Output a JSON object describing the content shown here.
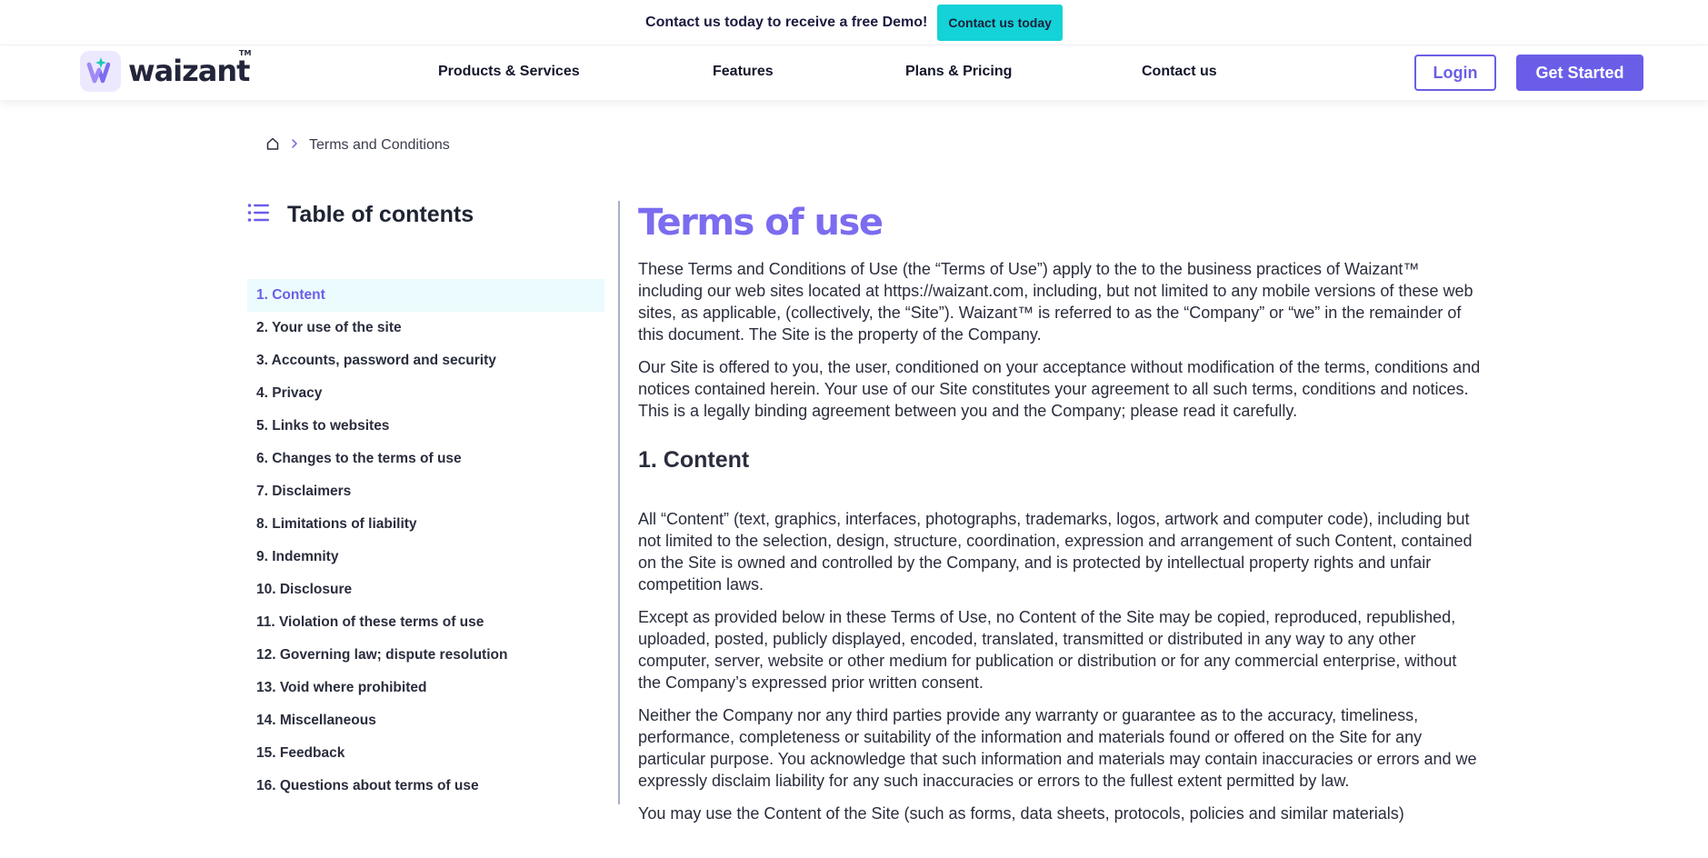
{
  "promo": {
    "text": "Contact us today to receive a free Demo!",
    "button_label": "Contact us today",
    "button_color": "#14d2d7"
  },
  "brand": {
    "name": "waizant",
    "tm": "TM",
    "accent": "#6a5ee8",
    "logo_icon": "waizant-w-sparkle-icon"
  },
  "nav": {
    "links": [
      "Products & Services",
      "Features",
      "Plans & Pricing",
      "Contact us"
    ],
    "login_label": "Login",
    "get_started_label": "Get Started"
  },
  "breadcrumb": {
    "home_icon": "home-icon",
    "separator_icon": "chevron-right-icon",
    "current": "Terms and Conditions"
  },
  "toc": {
    "title": "Table of contents",
    "icon": "list-icon",
    "active_index": 0,
    "items": [
      "1. Content",
      "2. Your use of the site",
      "3. Accounts, password and security",
      "4. Privacy",
      "5. Links to websites",
      "6. Changes to the terms of use",
      "7. Disclaimers",
      "8. Limitations of liability",
      "9. Indemnity",
      "10. Disclosure",
      "11. Violation of these terms of use",
      "12. Governing law; dispute resolution",
      "13. Void where prohibited",
      "14. Miscellaneous",
      "15. Feedback",
      "16. Questions about terms of use"
    ]
  },
  "main": {
    "title": "Terms of use",
    "intro": [
      "These Terms and Conditions of Use (the “Terms of Use”) apply to the to the business practices of Waizant™ including our web sites located at https://waizant.com, including, but not limited to any mobile versions of these web sites, as applicable, (collectively, the “Site”). Waizant™ is referred to as the “Company” or “we” in the remainder of this document. The Site is the property of the Company.",
      "Our Site is offered to you, the user, conditioned on your acceptance without modification of the terms, conditions and notices contained herein. Your use of our Site constitutes your agreement to all such terms, conditions and notices. This is a legally binding agreement between you and the Company; please read it carefully."
    ],
    "section1_title": "1. Content",
    "section1": [
      "All “Content” (text, graphics, interfaces, photographs, trademarks, logos, artwork and computer code), including but not limited to the selection, design, structure, coordination, expression and arrangement of such Content, contained on the Site is owned and controlled by the Company, and is protected by intellectual property rights and unfair competition laws.",
      "Except as provided below in these Terms of Use, no Content of the Site may be copied, reproduced, republished, uploaded, posted, publicly displayed, encoded, translated, transmitted or distributed in any way to any other computer, server, website or other medium for publication or distribution or for any commercial enterprise, without the Company’s expressed prior written consent.",
      "Neither the Company nor any third parties provide any warranty or guarantee as to the accuracy, timeliness, performance, completeness or suitability of the information and materials found or offered on the Site for any particular purpose. You acknowledge that such information and materials may contain inaccuracies or errors and we expressly disclaim liability for any such inaccuracies or errors to the fullest extent permitted by law.",
      "You may use the Content of the Site (such as forms, data sheets, protocols, policies and similar materials)"
    ]
  }
}
